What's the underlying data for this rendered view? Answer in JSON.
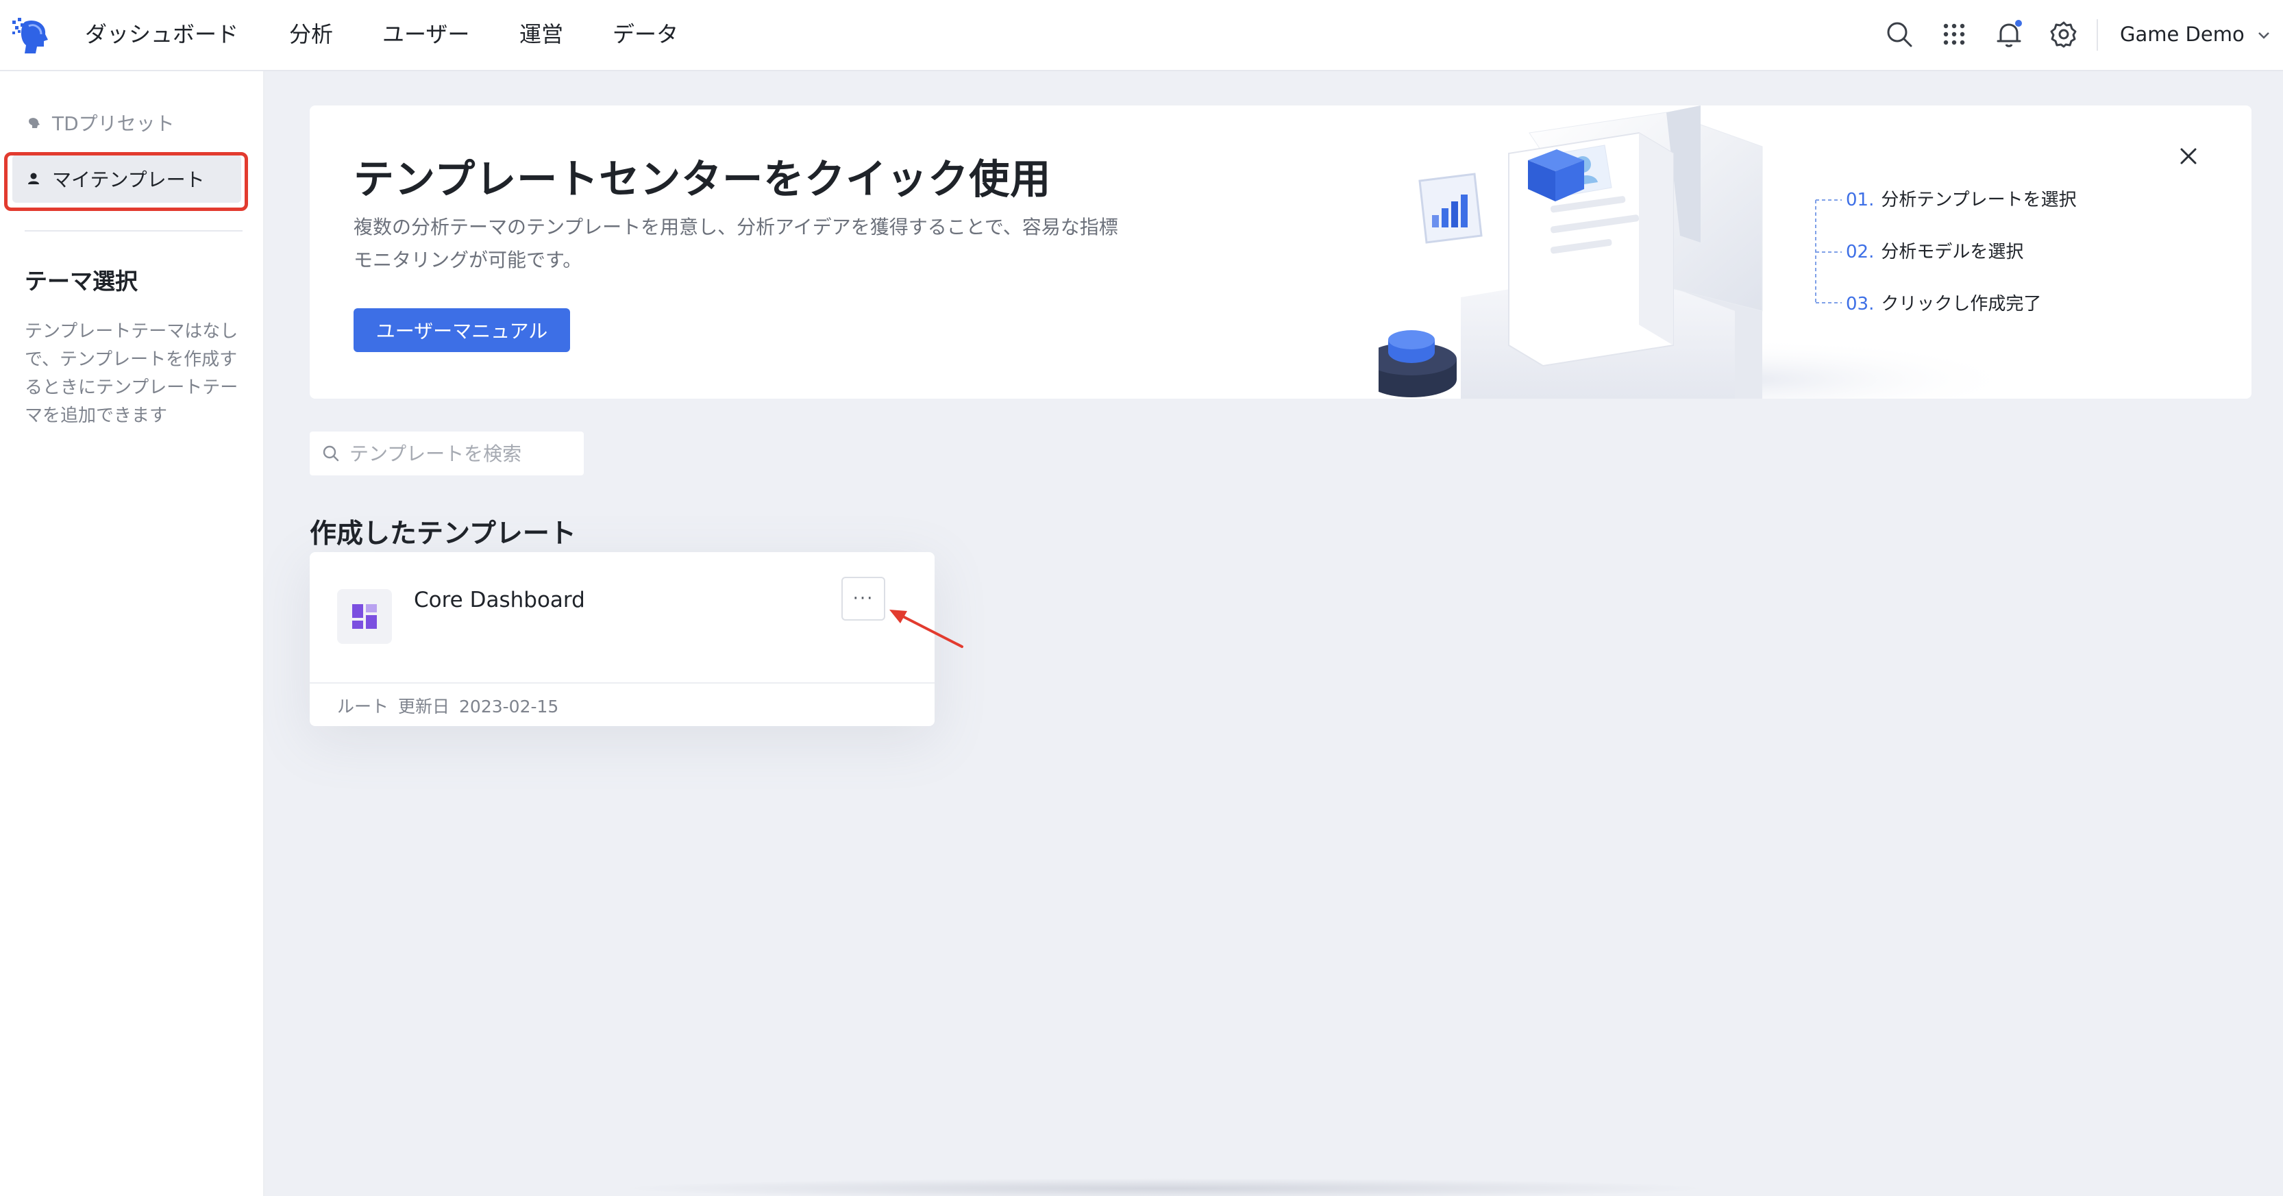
{
  "topbar": {
    "nav": [
      "ダッシュボード",
      "分析",
      "ユーザー",
      "運営",
      "データ"
    ],
    "project_name": "Game Demo",
    "icons": [
      "search-icon",
      "apps-grid-icon",
      "bell-icon",
      "settings-icon"
    ],
    "notification_dot": true
  },
  "sidebar": {
    "preset_label": "TDプリセット",
    "mine_label": "マイテンプレート",
    "theme_title": "テーマ選択",
    "theme_desc": "テンプレートテーマはなしで、テンプレートを作成するときにテンプレートテーマを追加できます"
  },
  "banner": {
    "title": "テンプレートセンターをクイック使用",
    "desc": "複数の分析テーマのテンプレートを用意し、分析アイデアを獲得することで、容易な指標モニタリングが可能です。",
    "button": "ユーザーマニュアル",
    "steps": [
      {
        "num": "01.",
        "text": "分析テンプレートを選択"
      },
      {
        "num": "02.",
        "text": "分析モデルを選択"
      },
      {
        "num": "03.",
        "text": "クリックし作成完了"
      }
    ]
  },
  "search": {
    "placeholder": "テンプレートを検索"
  },
  "section": {
    "title": "作成したテンプレート"
  },
  "card": {
    "title": "Core Dashboard",
    "more": "···",
    "owner": "ルート",
    "updated_label": "更新日",
    "updated_date": "2023-02-15"
  },
  "colors": {
    "accent": "#3d6fe6",
    "highlight": "#e23b2f",
    "background": "#eef0f5"
  }
}
